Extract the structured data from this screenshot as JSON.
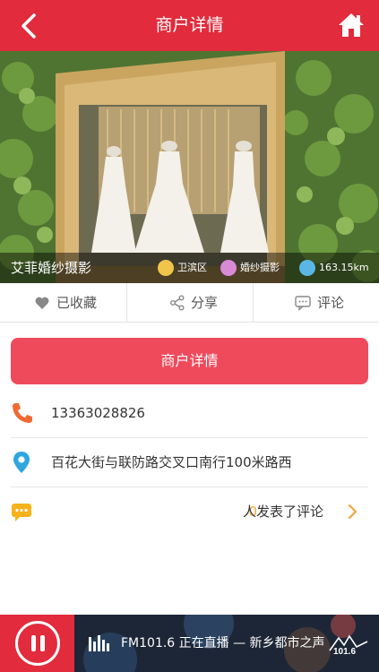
{
  "header": {
    "title": "商户详情"
  },
  "merchant": {
    "name": "艾菲婚纱摄影",
    "tags": [
      {
        "label": "卫滨区",
        "icon": "district-icon"
      },
      {
        "label": "婚纱摄影",
        "icon": "category-icon"
      },
      {
        "label": "163.15km",
        "icon": "location-pin-icon"
      }
    ]
  },
  "actions": {
    "favorite": "已收藏",
    "share": "分享",
    "comment": "评论"
  },
  "detail_button": "商户详情",
  "contact": {
    "phone": "13363028826",
    "address": "百花大街与联防路交叉口南行100米路西"
  },
  "comments": {
    "count": "0",
    "text": "人发表了评论"
  },
  "player": {
    "text": "FM101.6 正在直播 — 新乡都市之声",
    "logo_text": "101.6"
  },
  "colors": {
    "brand_red": "#e22b3c",
    "button_red": "#ef4a5c",
    "phone_orange": "#f06a35",
    "pin_blue": "#2fa7de",
    "comment_yellow": "#f5b21b",
    "count_orange": "#f0a63a"
  }
}
